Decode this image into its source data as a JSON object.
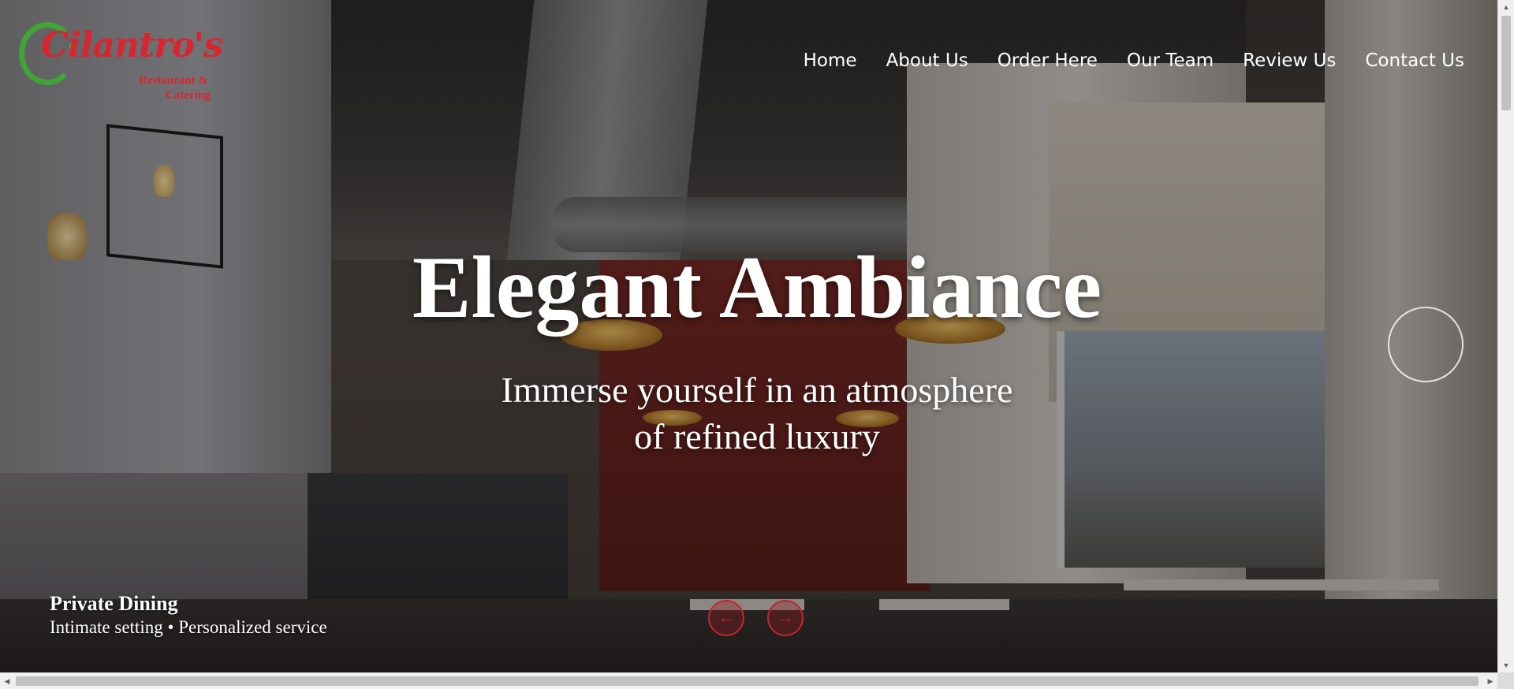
{
  "brand": {
    "logo_word": "Cilantro's",
    "logo_line1": "Restaurant &",
    "logo_line2": "Catering",
    "colors": {
      "red": "#d8252f",
      "green": "#3fa535"
    }
  },
  "nav": {
    "items": [
      {
        "label": "Home"
      },
      {
        "label": "About Us"
      },
      {
        "label": "Order Here"
      },
      {
        "label": "Our Team"
      },
      {
        "label": "Review Us"
      },
      {
        "label": "Contact Us"
      }
    ]
  },
  "hero": {
    "headline": "Elegant Ambiance",
    "subline_1": "Immerse yourself in an atmosphere",
    "subline_2": "of refined luxury",
    "caption_title": "Private Dining",
    "caption_text": "Intimate setting • Personalized service",
    "prev_icon": "arrow-left-icon",
    "next_icon": "arrow-right-icon",
    "prev_glyph": "←",
    "next_glyph": "→"
  },
  "scrollbars": {
    "up_glyph": "▲",
    "down_glyph": "▼",
    "left_glyph": "◀",
    "right_glyph": "▶"
  }
}
